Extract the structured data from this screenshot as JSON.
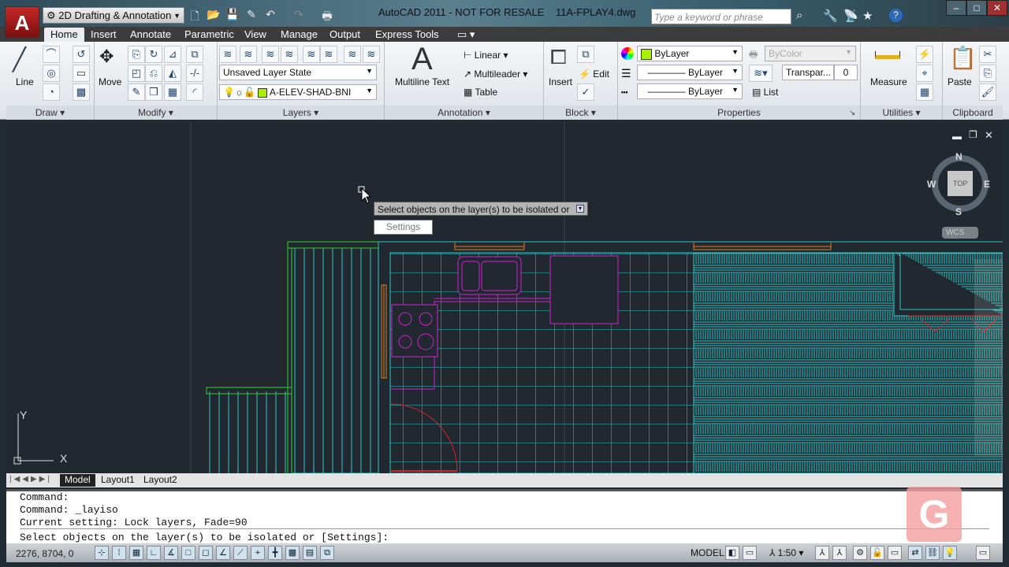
{
  "app": {
    "logo": "A",
    "workspace": "2D Drafting & Annotation",
    "title": "AutoCAD 2011 - NOT FOR RESALE",
    "file": "11A-FPLAY4.dwg",
    "search_placeholder": "Type a keyword or phrase"
  },
  "tabs": [
    {
      "label": "Home",
      "active": true
    },
    {
      "label": "Insert"
    },
    {
      "label": "Annotate"
    },
    {
      "label": "Parametric"
    },
    {
      "label": "View"
    },
    {
      "label": "Manage"
    },
    {
      "label": "Output"
    },
    {
      "label": "Express Tools"
    }
  ],
  "panels": {
    "draw": {
      "title": "Draw",
      "line": "Line"
    },
    "modify": {
      "title": "Modify",
      "move": "Move"
    },
    "layers": {
      "title": "Layers",
      "layer_state": "Unsaved Layer State",
      "current_layer": "A-ELEV-SHAD-BNI",
      "layer_color": "#aaee00"
    },
    "annotation": {
      "title": "Annotation",
      "mtext": "Multiline Text",
      "linear": "Linear",
      "multileader": "Multileader",
      "table": "Table"
    },
    "block": {
      "title": "Block",
      "insert": "Insert",
      "edit": "Edit"
    },
    "properties": {
      "title": "Properties",
      "color": "ByLayer",
      "plotstyle": "ByColor",
      "lineweight": "ByLayer",
      "linetype": "ByLayer",
      "transparency_label": "Transpar...",
      "transparency_value": "0",
      "list": "List"
    },
    "utilities": {
      "title": "Utilities",
      "measure": "Measure"
    },
    "clipboard": {
      "title": "Clipboard",
      "paste": "Paste"
    }
  },
  "viewcube": {
    "n": "N",
    "s": "S",
    "e": "E",
    "w": "W",
    "face": "TOP",
    "wcs": "WCS"
  },
  "prompt": {
    "tooltip": "Select objects on the layer(s) to be isolated or",
    "option": "Settings"
  },
  "layout_tabs": [
    "Model",
    "Layout1",
    "Layout2"
  ],
  "command_lines": [
    "Command:",
    "Command: _layiso",
    "Current setting: Lock layers, Fade=90",
    "Select objects on the layer(s) to be isolated or [Settings]:"
  ],
  "status": {
    "coords": "2276, 8704, 0",
    "model": "MODEL",
    "scale": "1:50"
  },
  "colors": {
    "canvas": "#212830",
    "cyan": "#2bc8c8",
    "magenta": "#d020d0",
    "orange": "#e08020",
    "green": "#30d030",
    "red": "#e02020"
  }
}
